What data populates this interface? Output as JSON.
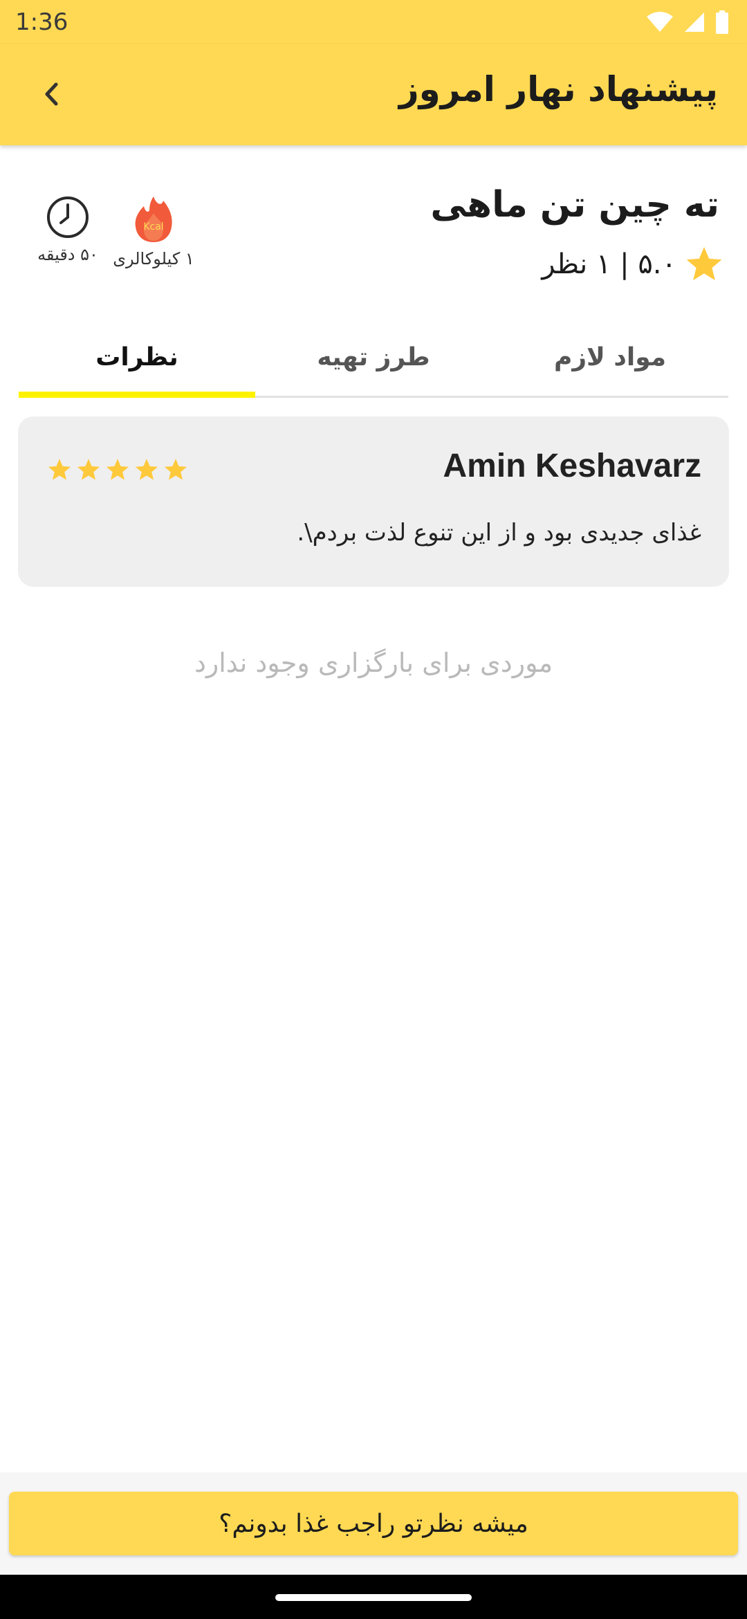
{
  "status_bar": {
    "time": "1:36"
  },
  "app_bar": {
    "title": "پیشنهاد نهار امروز"
  },
  "recipe": {
    "title": "ته چین تن ماهی",
    "rating_text": "۵.۰ | ۱ نظر",
    "calories_label": "۱ کیلوکالری",
    "time_label": "۵۰ دقیقه",
    "calorie_icon_text": "Kcal"
  },
  "tabs": [
    {
      "label": "مواد لازم",
      "active": false
    },
    {
      "label": "طرز تهیه",
      "active": false
    },
    {
      "label": "نظرات",
      "active": true
    }
  ],
  "review": {
    "author": "Amin Keshavarz",
    "stars": 5,
    "text": "غذای جدیدی بود و از این تنوع لذت بردم\\."
  },
  "empty_message": "موردی برای بارگزاری وجود ندارد",
  "cta": {
    "label": "میشه نظرتو راجب غذا بدونم؟"
  },
  "colors": {
    "accent": "#FFD953",
    "tab_indicator": "#FFF200",
    "star": "#FFC93C",
    "calorie": "#F15A3A"
  }
}
